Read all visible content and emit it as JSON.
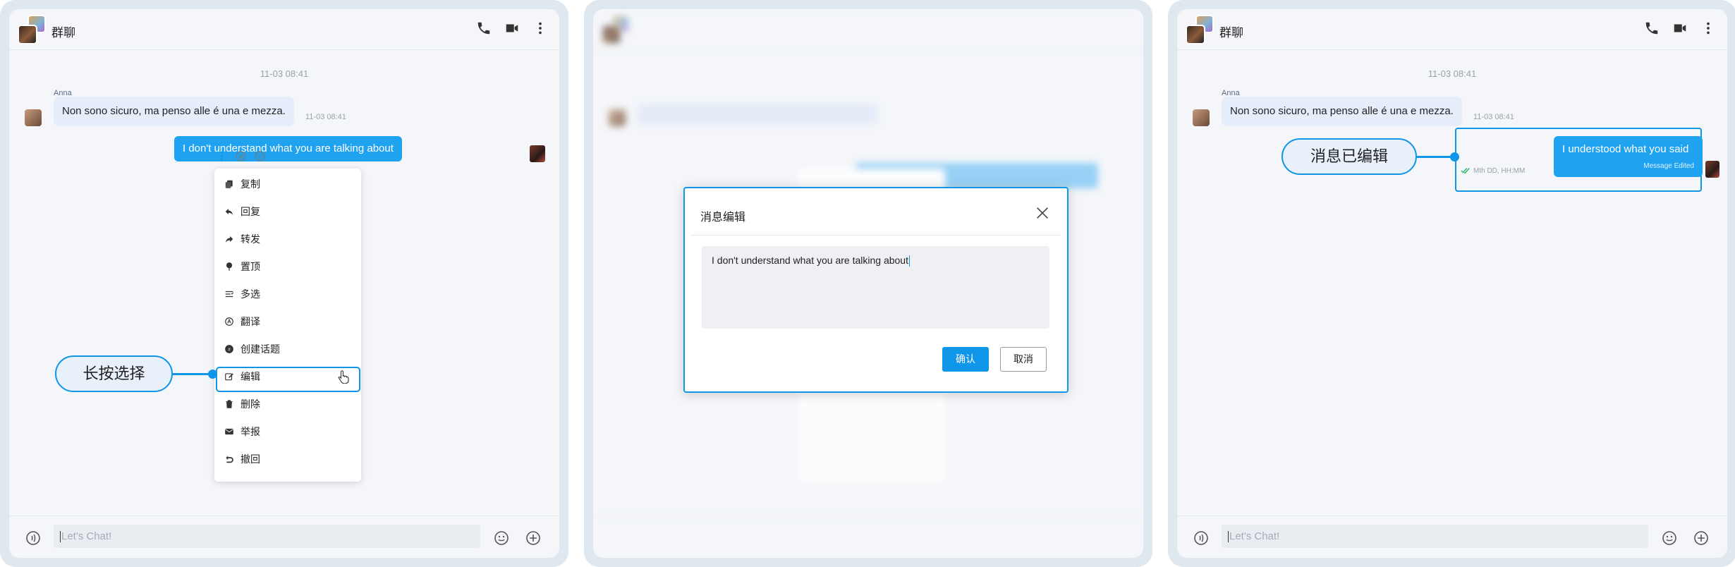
{
  "chat": {
    "title": "群聊",
    "date_divider": "11-03 08:41",
    "sender": "Anna",
    "incoming_text": "Non sono sicuro, ma penso alle é una e mezza.",
    "incoming_time": "11-03 08:41",
    "outgoing_text": "I don't understand what you are talking about",
    "input_placeholder": "Let's Chat!"
  },
  "context_menu": {
    "items": [
      {
        "label": "复制",
        "icon": "copy-icon"
      },
      {
        "label": "回复",
        "icon": "reply-icon"
      },
      {
        "label": "转发",
        "icon": "forward-icon"
      },
      {
        "label": "置顶",
        "icon": "pin-icon"
      },
      {
        "label": "多选",
        "icon": "multi-select-icon"
      },
      {
        "label": "翻译",
        "icon": "translate-icon"
      },
      {
        "label": "创建话题",
        "icon": "topic-icon"
      },
      {
        "label": "编辑",
        "icon": "edit-icon"
      },
      {
        "label": "删除",
        "icon": "trash-icon"
      },
      {
        "label": "举报",
        "icon": "report-icon"
      },
      {
        "label": "撤回",
        "icon": "recall-icon"
      }
    ],
    "selected": "编辑"
  },
  "annotations": {
    "step1": "长按选择",
    "step3": "消息已编辑"
  },
  "edit_dialog": {
    "title": "消息编辑",
    "text": "I don't understand what you are talking about",
    "confirm_label": "确认",
    "cancel_label": "取消"
  },
  "edited_message": {
    "text": "I understood what you said",
    "flag": "Message Edited",
    "meta": "Mth DD, HH:MM"
  },
  "colors": {
    "accent": "#1096e8",
    "bubble_out": "#1fa3f1",
    "bubble_in": "#e6eefc"
  }
}
